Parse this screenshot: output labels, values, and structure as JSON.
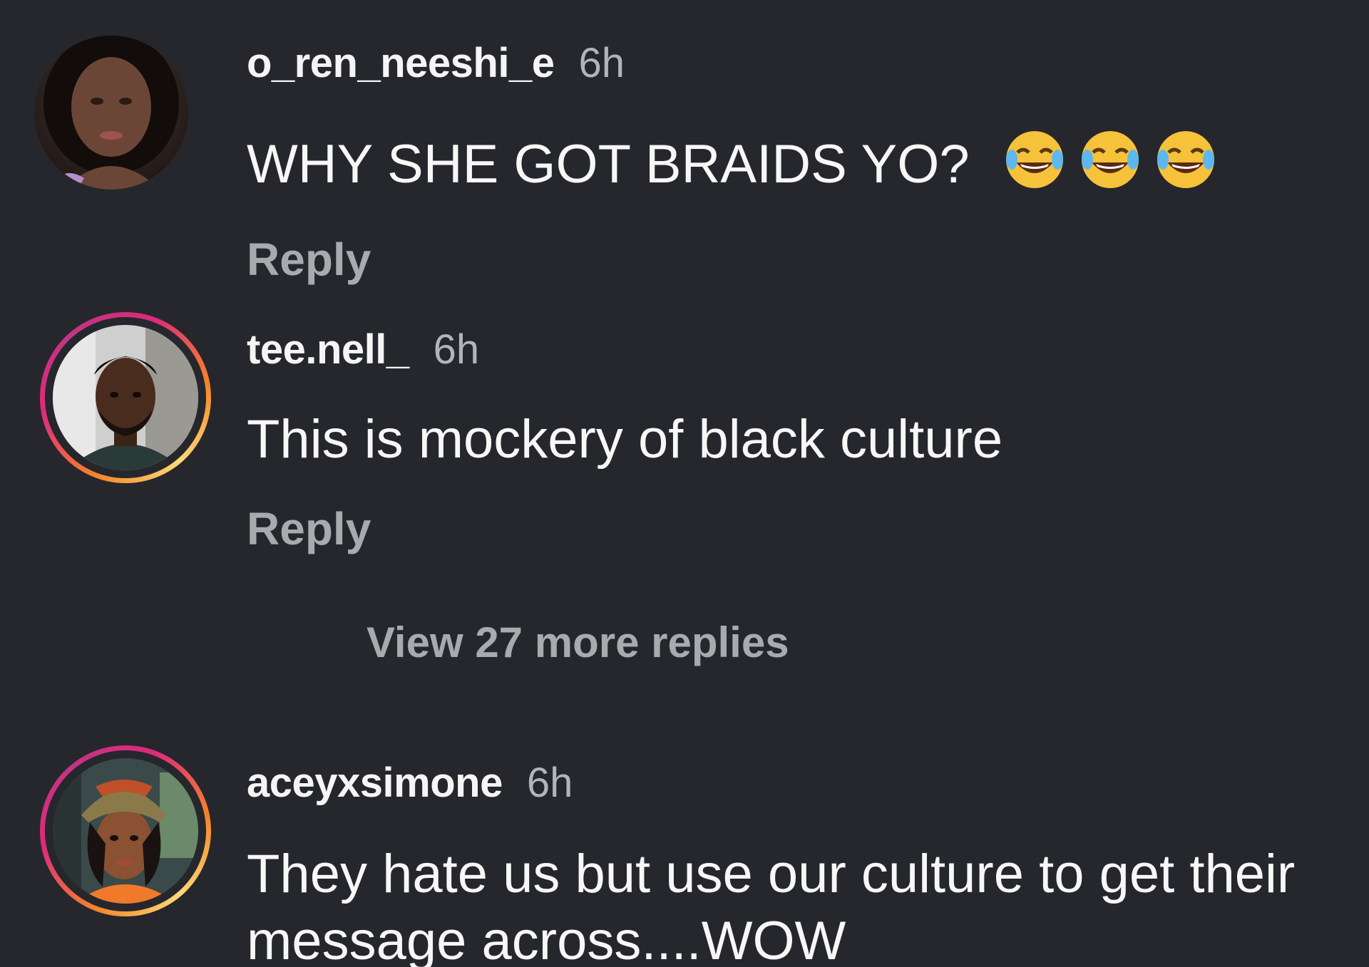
{
  "comments": [
    {
      "username": "o_ren_neeshi_e",
      "time": "6h",
      "text": "WHY SHE GOT BRAIDS YO?",
      "emojis": [
        "face-with-tears-of-joy",
        "face-with-tears-of-joy",
        "face-with-tears-of-joy"
      ],
      "reply_label": "Reply",
      "has_story_ring": false
    },
    {
      "username": "tee.nell_",
      "time": "6h",
      "text": "This is mockery of black culture",
      "reply_label": "Reply",
      "has_story_ring": true
    },
    {
      "username": "aceyxsimone",
      "time": "6h",
      "text": "They hate us but use our culture to get their message across....WOW",
      "has_story_ring": true
    }
  ],
  "view_more_replies": "View 27 more replies",
  "colors": {
    "background": "#25272c",
    "text_primary": "#f5f5f5",
    "text_secondary": "#a9aaae",
    "story_ring": [
      "#f58529",
      "#dd2a7b",
      "#c13584"
    ]
  }
}
